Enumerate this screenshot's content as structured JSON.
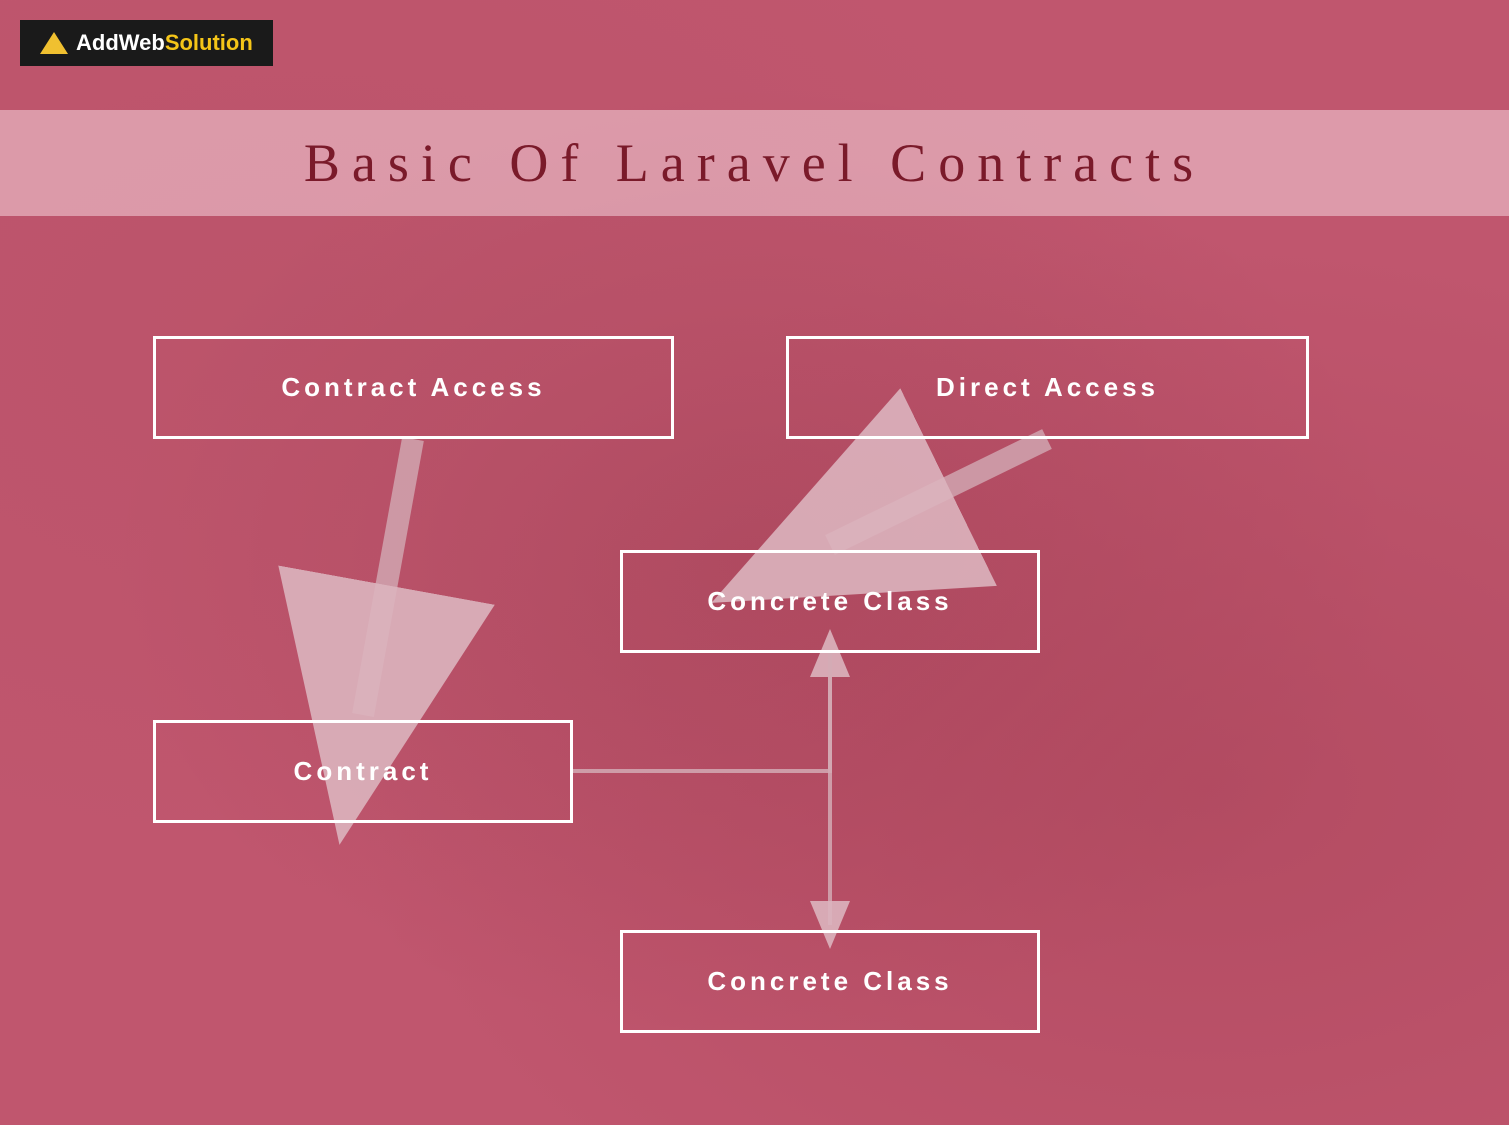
{
  "logo": {
    "company": "AddWeb",
    "highlight": "Solution",
    "icon": "triangle"
  },
  "title": {
    "text": "Basic Of Laravel Contracts",
    "letter_spacing": "12px"
  },
  "diagram": {
    "boxes": [
      {
        "id": "contract-access",
        "label": "Contract Access"
      },
      {
        "id": "direct-access",
        "label": "Direct Access"
      },
      {
        "id": "concrete-class-top",
        "label": "Concrete Class"
      },
      {
        "id": "contract",
        "label": "Contract"
      },
      {
        "id": "concrete-class-bottom",
        "label": "Concrete Class"
      }
    ]
  },
  "colors": {
    "background": "#c0566e",
    "title_bg": "rgba(240,200,210,0.6)",
    "title_text": "#7a1a2a",
    "box_border": "white",
    "box_text": "white",
    "arrow_fill": "rgba(220,180,190,0.8)",
    "arrow_stroke": "rgba(200,160,170,0.9)",
    "logo_bg": "#1a1a1a",
    "logo_text": "white",
    "logo_highlight": "#f5c518"
  }
}
